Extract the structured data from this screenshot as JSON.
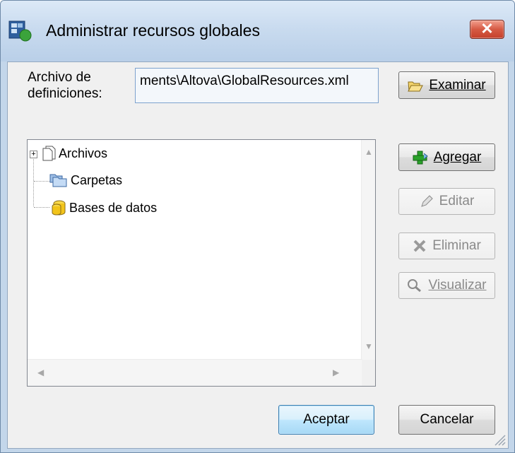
{
  "window": {
    "title": "Administrar recursos globales",
    "close_label": "✕"
  },
  "definitions": {
    "label_line1": "Archivo de",
    "label_line2": "definiciones:",
    "path_value": "ments\\Altova\\GlobalResources.xml",
    "browse_label": "Examinar"
  },
  "tree": {
    "items": [
      {
        "label": "Archivos",
        "expander": "+"
      },
      {
        "label": "Carpetas"
      },
      {
        "label": "Bases de datos"
      }
    ]
  },
  "side_buttons": {
    "add": "Agregar",
    "edit": "Editar",
    "delete": "Eliminar",
    "view": "Visualizar"
  },
  "footer": {
    "ok": "Aceptar",
    "cancel": "Cancelar"
  },
  "colors": {
    "title_bar": "#c9dbef",
    "close_button": "#d65a44",
    "add_icon": "#2aa22a",
    "db_icon": "#f2c41a"
  }
}
